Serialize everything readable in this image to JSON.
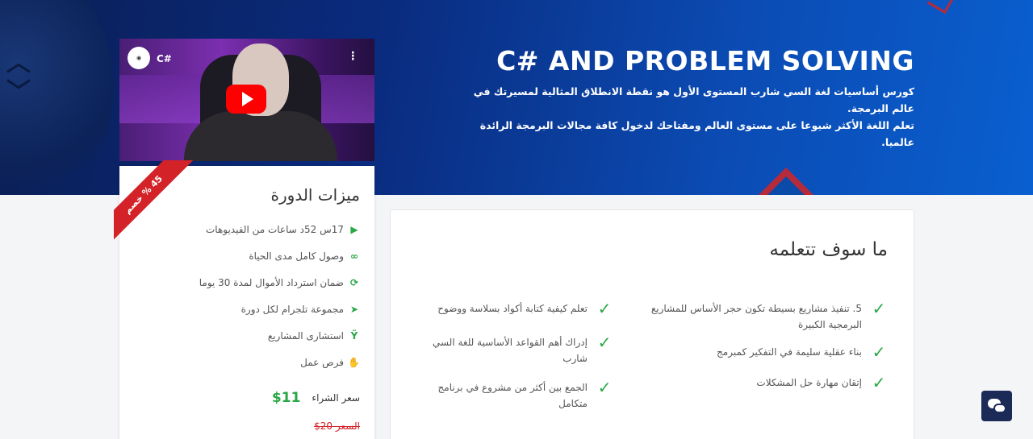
{
  "hero": {
    "title": "C# AND PROBLEM SOLVING",
    "description_1": "كورس أساسيات لغة السي شارب المستوى الأول هو نقطة الانطلاق المثالية لمسيرتك في عالم البرمجة.",
    "description_2": "تعلم اللغة الأكثر شيوعا على مستوى العالم ومفتاحك لدخول كافة مجالات البرمجة الرائدة عالميا."
  },
  "video": {
    "title": "C#",
    "channel_logo": "logo",
    "play_icon": "play-icon",
    "menu_icon": "more-vertical-icon"
  },
  "features": {
    "heading": "ميزات الدورة",
    "discount_badge": "45 % خصم",
    "items": [
      {
        "icon": "play-icon",
        "text": "17س 52د ساعات من الفيديوهات"
      },
      {
        "icon": "infinity-icon",
        "text": "وصول كامل مدى الحياة"
      },
      {
        "icon": "refresh-icon",
        "text": "ضمان استرداد الأموال لمدة 30 يوما"
      },
      {
        "icon": "telegram-icon",
        "text": "مجموعة تلجرام لكل دورة"
      },
      {
        "icon": "branch-icon",
        "text": "استشارى المشاريع"
      },
      {
        "icon": "handshake-icon",
        "text": "فرص عمل"
      }
    ],
    "price_label": "سعر الشراء",
    "price_now": "$11",
    "old_price": "السعر 20$"
  },
  "learn": {
    "heading": "ما سوف تتعلمه",
    "right_items": [
      "5. تنفيذ مشاريع بسيطة تكون حجر الأساس للمشاريع البرمجية الكبيرة",
      "بناء عقلية سليمة في التفكير كمبرمج",
      "إتقان مهارة حل المشكلات"
    ],
    "left_items": [
      "تعلم كيفية كتابة أكواد بسلاسة ووضوح",
      "إدراك أهم القواعد الأساسية للغة السي شارب",
      "الجمع بين أكثر من مشروع في برنامج متكامل"
    ]
  },
  "chat": {
    "icon": "chat-icon"
  },
  "colors": {
    "accent_green": "#28a745",
    "ribbon_red": "#d32228",
    "hero_blue": "#0b4bb3"
  }
}
